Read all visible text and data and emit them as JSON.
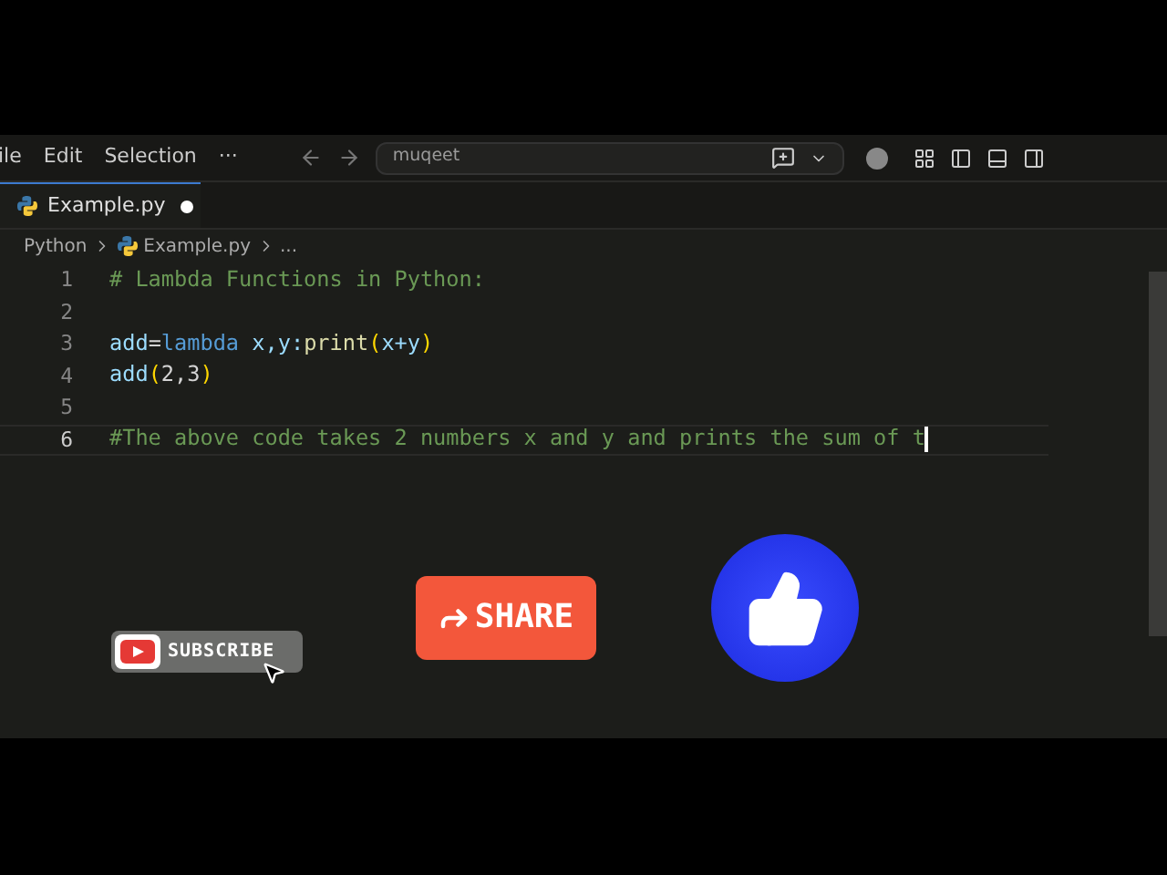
{
  "menu": [
    "ile",
    "Edit",
    "Selection",
    "···"
  ],
  "search": {
    "value": "muqeet"
  },
  "tab": {
    "label": "Example.py",
    "modified": true
  },
  "breadcrumbs": [
    "Python",
    "Example.py",
    "..."
  ],
  "lines": [
    {
      "number": "1",
      "current": false,
      "tokens": [
        {
          "text": "# Lambda Functions in Python:",
          "kind": "comment"
        }
      ]
    },
    {
      "number": "2",
      "current": false
    },
    {
      "number": "3",
      "current": false,
      "tokens": [
        {
          "text": "add",
          "kind": "name"
        },
        {
          "text": "=",
          "kind": "plain"
        },
        {
          "text": "lambda",
          "kind": "keyword"
        },
        {
          "text": " x,y:",
          "kind": "name"
        },
        {
          "text": "print",
          "kind": "function"
        },
        {
          "text": "(",
          "kind": "paren"
        },
        {
          "text": "x+y",
          "kind": "name"
        },
        {
          "text": ")",
          "kind": "paren"
        }
      ]
    },
    {
      "number": "4",
      "current": false,
      "tokens": [
        {
          "text": "add",
          "kind": "name"
        },
        {
          "text": "(",
          "kind": "paren"
        },
        {
          "text": "2,3",
          "kind": "plain"
        },
        {
          "text": ")",
          "kind": "paren"
        }
      ]
    },
    {
      "number": "5",
      "current": false
    },
    {
      "number": "6",
      "current": true,
      "tokens": [
        {
          "text": "#The above code takes 2 numbers x and y and prints the sum of t",
          "kind": "comment"
        }
      ]
    }
  ],
  "overlays": {
    "subscribe": "SUBSCRIBE",
    "share": "SHARE"
  }
}
